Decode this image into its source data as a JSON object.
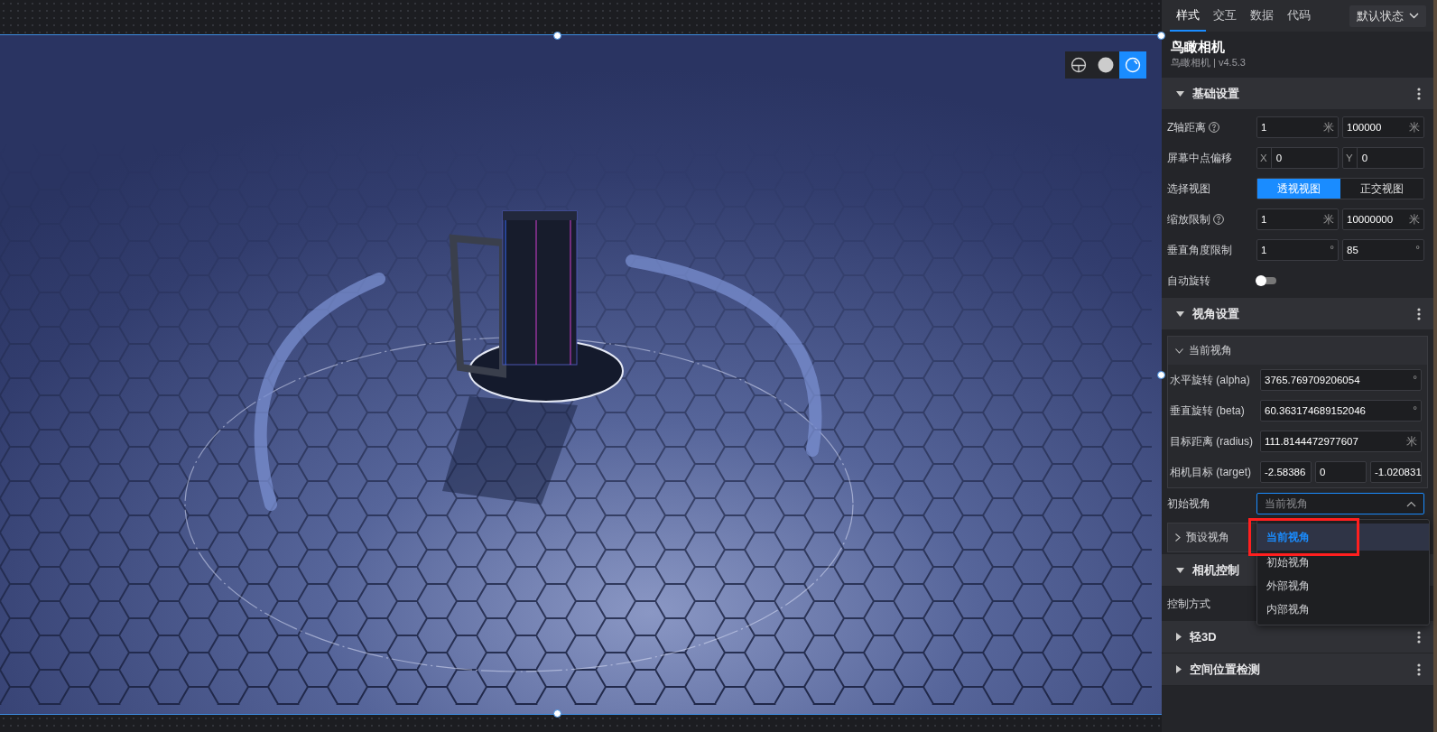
{
  "view_toolbar": [
    {
      "kind": "wireframe",
      "selected": false
    },
    {
      "kind": "solid",
      "selected": false
    },
    {
      "kind": "ring",
      "selected": true
    }
  ],
  "panel": {
    "tabs": [
      {
        "label": "样式",
        "selected": true
      },
      {
        "label": "交互",
        "selected": false
      },
      {
        "label": "数据",
        "selected": false
      },
      {
        "label": "代码",
        "selected": false
      }
    ],
    "state_dropdown": {
      "value": "默认状态"
    },
    "component": {
      "title": "鸟瞰相机",
      "subtitle": "鸟瞰相机 | v4.5.3"
    },
    "sections": [
      {
        "title": "基础设置",
        "expanded": true,
        "menu_button": true,
        "rows": [
          {
            "kind": "fields",
            "label": "Z轴距离",
            "help": true,
            "fields": [
              {
                "value": "1",
                "unit": "米"
              },
              {
                "value": "100000",
                "unit": "米"
              }
            ]
          },
          {
            "kind": "fields",
            "label": "屏幕中点偏移",
            "help": false,
            "fields": [
              {
                "prefix": "X",
                "value": "0"
              },
              {
                "prefix": "Y",
                "value": "0"
              }
            ]
          },
          {
            "kind": "segmented",
            "label": "选择视图",
            "options": [
              {
                "label": "透视视图",
                "selected": true
              },
              {
                "label": "正交视图",
                "selected": false
              }
            ]
          },
          {
            "kind": "fields",
            "label": "缩放限制",
            "help": true,
            "fields": [
              {
                "value": "1",
                "unit": "米"
              },
              {
                "value": "10000000",
                "unit": "米"
              }
            ]
          },
          {
            "kind": "fields",
            "label": "垂直角度限制",
            "help": false,
            "fields": [
              {
                "value": "1",
                "unit": "°"
              },
              {
                "value": "85",
                "unit": "°"
              }
            ]
          },
          {
            "kind": "toggle",
            "label": "自动旋转",
            "on": false
          }
        ]
      },
      {
        "title": "视角设置",
        "expanded": true,
        "menu_button": true,
        "rows": [
          {
            "kind": "group",
            "title": "当前视角",
            "expanded": true,
            "rows": [
              {
                "kind": "fields",
                "label": "水平旋转 (alpha)",
                "help": false,
                "fields": [
                  {
                    "value": "3765.769709206054",
                    "unit": "°"
                  }
                ]
              },
              {
                "kind": "fields",
                "label": "垂直旋转 (beta)",
                "help": false,
                "fields": [
                  {
                    "value": "60.363174689152046",
                    "unit": "°"
                  }
                ]
              },
              {
                "kind": "fields",
                "label": "目标距离 (radius)",
                "help": false,
                "fields": [
                  {
                    "value": "111.8144472977607",
                    "unit": "米"
                  }
                ]
              },
              {
                "kind": "fields",
                "label": "相机目标 (target)",
                "help": false,
                "fields": [
                  {
                    "value": "-2.58386"
                  },
                  {
                    "value": "0"
                  },
                  {
                    "value": "-1.020831"
                  }
                ]
              }
            ]
          },
          {
            "kind": "select",
            "label": "初始视角",
            "value": "当前视角",
            "open": true,
            "options": [
              {
                "label": "当前视角",
                "selected": true,
                "highlighted": true
              },
              {
                "label": "初始视角",
                "selected": false,
                "highlighted": false
              },
              {
                "label": "外部视角",
                "selected": false,
                "highlighted": false
              },
              {
                "label": "内部视角",
                "selected": false,
                "highlighted": false
              }
            ]
          },
          {
            "kind": "group",
            "title": "预设视角",
            "expanded": false,
            "rows": []
          }
        ]
      },
      {
        "title": "相机控制",
        "expanded": true,
        "menu_button": false,
        "rows": [
          {
            "kind": "label",
            "label": "控制方式"
          }
        ]
      },
      {
        "title": "轻3D",
        "expanded": false,
        "menu_button": true
      },
      {
        "title": "空间位置检测",
        "expanded": false,
        "menu_button": true
      }
    ]
  }
}
